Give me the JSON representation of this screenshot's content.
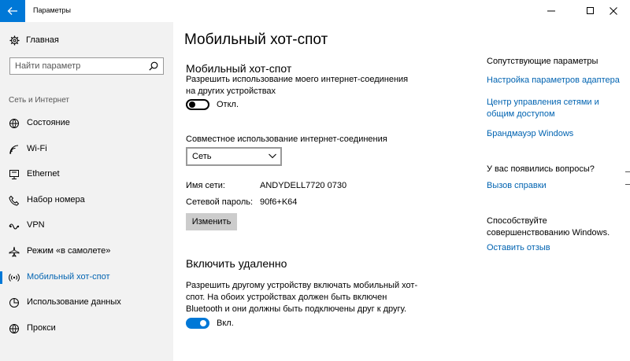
{
  "window": {
    "title": "Параметры",
    "controls": [
      "minimize-icon",
      "maximize-icon",
      "close-icon"
    ]
  },
  "sidebar": {
    "home_label": "Главная",
    "search_placeholder": "Найти параметр",
    "section_header": "Сеть и Интернет",
    "items": [
      {
        "label": "Состояние",
        "icon": "status-icon"
      },
      {
        "label": "Wi-Fi",
        "icon": "wifi-icon"
      },
      {
        "label": "Ethernet",
        "icon": "ethernet-icon"
      },
      {
        "label": "Набор номера",
        "icon": "dial-up-icon"
      },
      {
        "label": "VPN",
        "icon": "vpn-icon"
      },
      {
        "label": "Режим «в самолете»",
        "icon": "airplane-icon"
      },
      {
        "label": "Мобильный хот-спот",
        "icon": "hotspot-icon",
        "active": true
      },
      {
        "label": "Использование данных",
        "icon": "data-usage-icon"
      },
      {
        "label": "Прокси",
        "icon": "proxy-icon"
      }
    ]
  },
  "main": {
    "page_title": "Мобильный хот-спот",
    "hotspot_heading": "Мобильный хот-спот",
    "share_description": "Разрешить использование моего интернет-соединения на других устройствах",
    "share_toggle": {
      "state": "off",
      "label": "Откл."
    },
    "sharing_label": "Совместное использование интернет-соединения",
    "sharing_select": {
      "selected": "Сеть"
    },
    "network_name_label": "Имя сети:",
    "network_name_value": "ANDYDELL7720 0730",
    "network_password_label": "Сетевой пароль:",
    "network_password_value": "90f6+K64",
    "edit_button": "Изменить",
    "remote_heading": "Включить удаленно",
    "remote_description": "Разрешить другому устройству включать мобильный хот-спот. На обоих устройствах должен быть включен Bluetooth и они должны быть подключены друг к другу.",
    "remote_toggle": {
      "state": "on",
      "label": "Вкл."
    }
  },
  "right": {
    "related_header": "Сопутствующие параметры",
    "links": [
      "Настройка параметров адаптера",
      "Центр управления сетями и общим доступом",
      "Брандмауэр Windows"
    ],
    "questions_header": "У вас появились вопросы?",
    "help_link": "Вызов справки",
    "improve_text_1": "Способствуйте",
    "improve_text_2": "совершенствованию Windows.",
    "feedback_link": "Оставить отзыв"
  },
  "colors": {
    "accent": "#0078d7",
    "link": "#0063b1",
    "sidebar_bg": "#f2f2f2",
    "button_bg": "#cccccc"
  }
}
